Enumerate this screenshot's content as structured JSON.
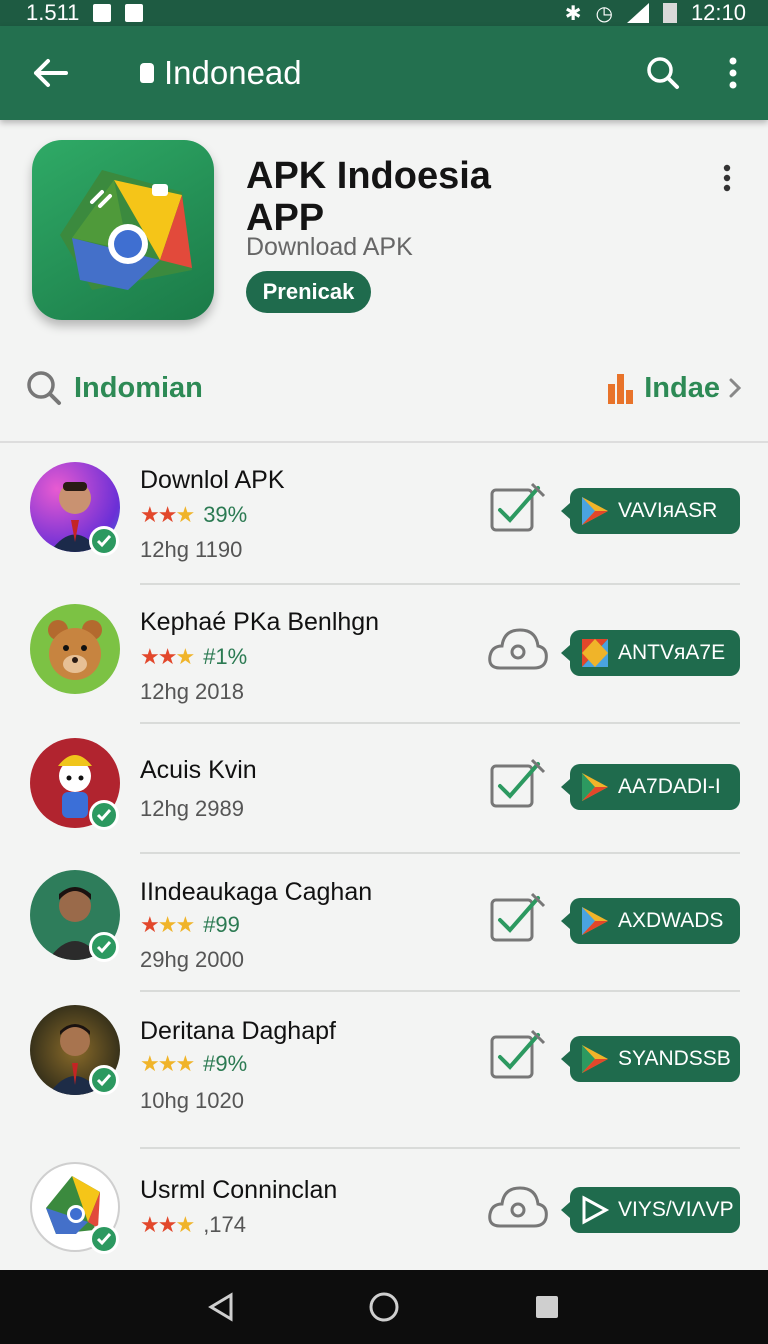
{
  "status_bar": {
    "time_left": "1.511",
    "time_right": "12:10"
  },
  "app_bar": {
    "title": "Indonead"
  },
  "header": {
    "app_name": "APK Indoesia APP",
    "subtitle": "Download APK",
    "primary_button": "Prenicak"
  },
  "search": {
    "query": "Indomian",
    "right_label": "Indae"
  },
  "list": [
    {
      "name": "Downlol APK",
      "stars": 3,
      "rating": "39%",
      "meta": "12hg 1190",
      "action_icon": "checkbox-icon",
      "button": "VAVIᴙASR"
    },
    {
      "name": "Kephaé PKa Benlhgn",
      "stars": 3,
      "rating": "#1%",
      "meta": "12hg 2018",
      "action_icon": "cloud-icon",
      "button": "ANTVᴙA7E"
    },
    {
      "name": "Acuis Kvin",
      "stars": 0,
      "rating": "",
      "meta": "12hg 2989",
      "action_icon": "checkbox-icon",
      "button": "AA7DADI-I"
    },
    {
      "name": "IIndeaukaga Caghan",
      "stars": 3,
      "rating": "#99",
      "meta": "29hg 2000",
      "action_icon": "checkbox-icon",
      "button": "AXDWADS"
    },
    {
      "name": "Deritana Daghapf",
      "stars": 3,
      "rating": "#9%",
      "meta": "10hg 1020",
      "action_icon": "checkbox-icon",
      "button": "SYANDSSB"
    },
    {
      "name": "Usrml Conninclan",
      "stars": 3,
      "rating": ",174",
      "meta": "",
      "action_icon": "cloud-icon",
      "button": "VIYS/VIɅVP"
    }
  ],
  "colors": {
    "primary": "#23704f",
    "accent": "#2d8a55",
    "star_red": "#e2472b",
    "star_gold": "#f0b429"
  }
}
